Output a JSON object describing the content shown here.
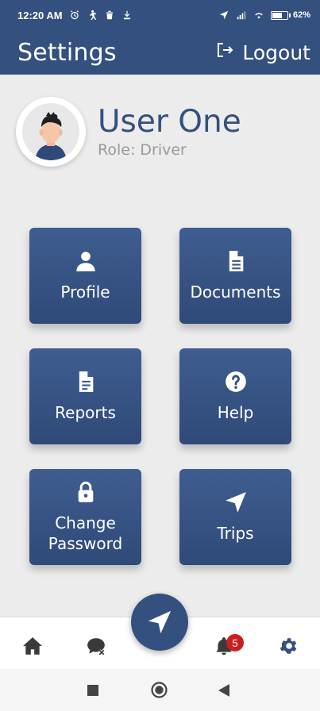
{
  "status_bar": {
    "time": "12:20 AM",
    "battery_level": "62%",
    "battery_fraction": 0.62
  },
  "app_bar": {
    "title": "Settings",
    "logout_label": "Logout"
  },
  "profile": {
    "name": "User One",
    "role": "Role: Driver"
  },
  "tiles": [
    {
      "label": "Profile",
      "icon": "person-icon"
    },
    {
      "label": "Documents",
      "icon": "document-icon"
    },
    {
      "label": "Reports",
      "icon": "report-icon"
    },
    {
      "label": "Help",
      "icon": "help-icon"
    },
    {
      "label": "Change Password",
      "icon": "lock-icon"
    },
    {
      "label": "Trips",
      "icon": "navigation-icon"
    }
  ],
  "bottom_nav": {
    "items": [
      "home-icon",
      "chat-icon",
      "navigate-icon",
      "notifications-icon",
      "settings-icon"
    ],
    "notification_count": "5",
    "active": "settings-icon"
  },
  "colors": {
    "primary": "#34507e",
    "badge": "#c82020",
    "background": "#ececec"
  }
}
